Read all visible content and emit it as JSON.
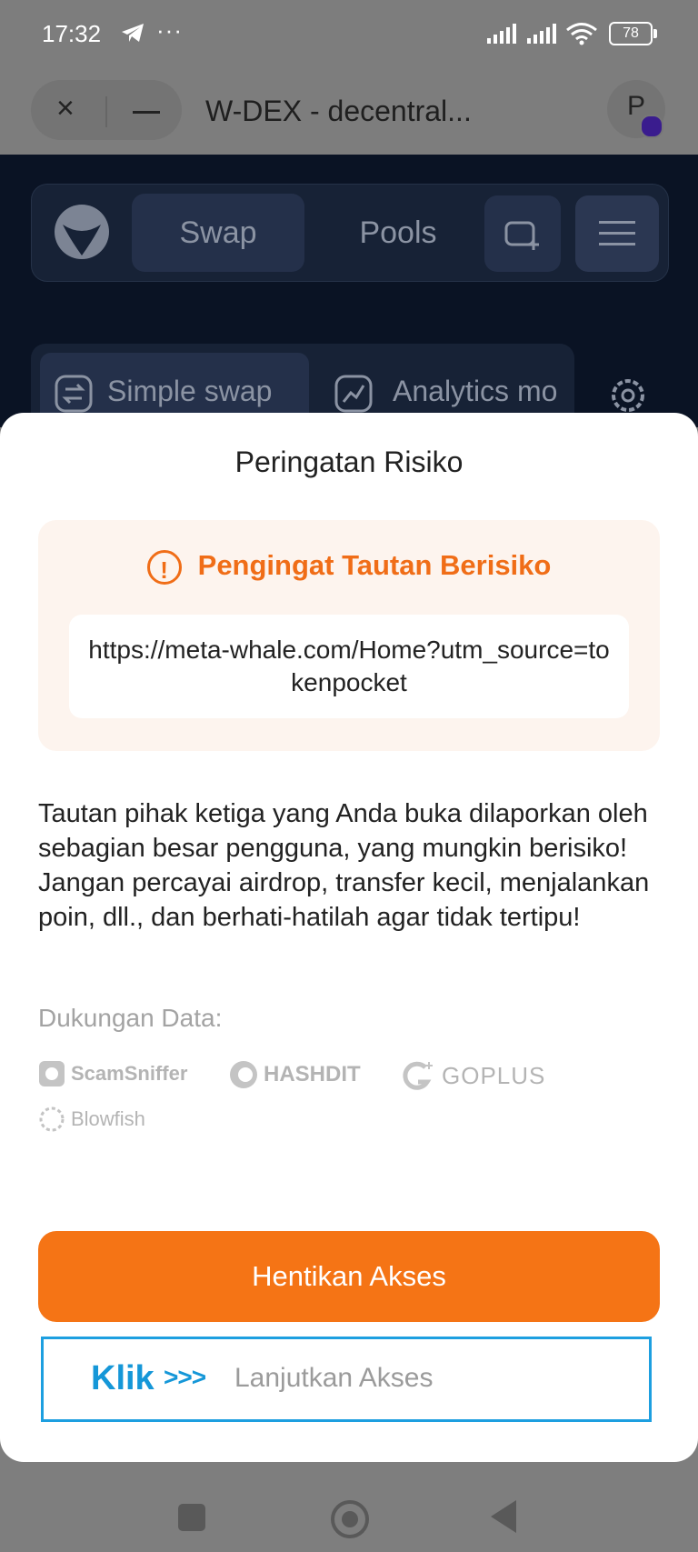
{
  "status_bar": {
    "time": "17:32",
    "more": "···",
    "battery": "78"
  },
  "browser": {
    "title": "W-DEX - decentral...",
    "close": "×",
    "avatar_letter": "P"
  },
  "app_nav": {
    "swap": "Swap",
    "pools": "Pools"
  },
  "mode_tabs": {
    "simple": "Simple swap",
    "analytics": "Analytics mo"
  },
  "sheet": {
    "title": "Peringatan Risiko",
    "warning_title": "Pengingat Tautan Berisiko",
    "warning_icon": "!",
    "url": "https://meta-whale.com/Home?utm_source=tokenpocket",
    "description": "Tautan pihak ketiga yang Anda buka dilaporkan oleh sebagian besar pengguna, yang mungkin berisiko! Jangan percayai airdrop, transfer kecil, menjalankan poin, dll., dan berhati-hatilah agar tidak tertipu!",
    "support_label": "Dukungan Data:",
    "providers": [
      "ScamSniffer",
      "HASHDIT",
      "GOPLUS",
      "Blowfish"
    ],
    "stop_button": "Hentikan Akses",
    "continue_button": "Lanjutkan Akses",
    "klik": "Klik",
    "arrows": ">>>"
  },
  "colors": {
    "accent_orange": "#f57415",
    "warning_orange": "#f06d17",
    "highlight_blue": "#1d9fe0",
    "dark_bg": "#0a1324"
  }
}
